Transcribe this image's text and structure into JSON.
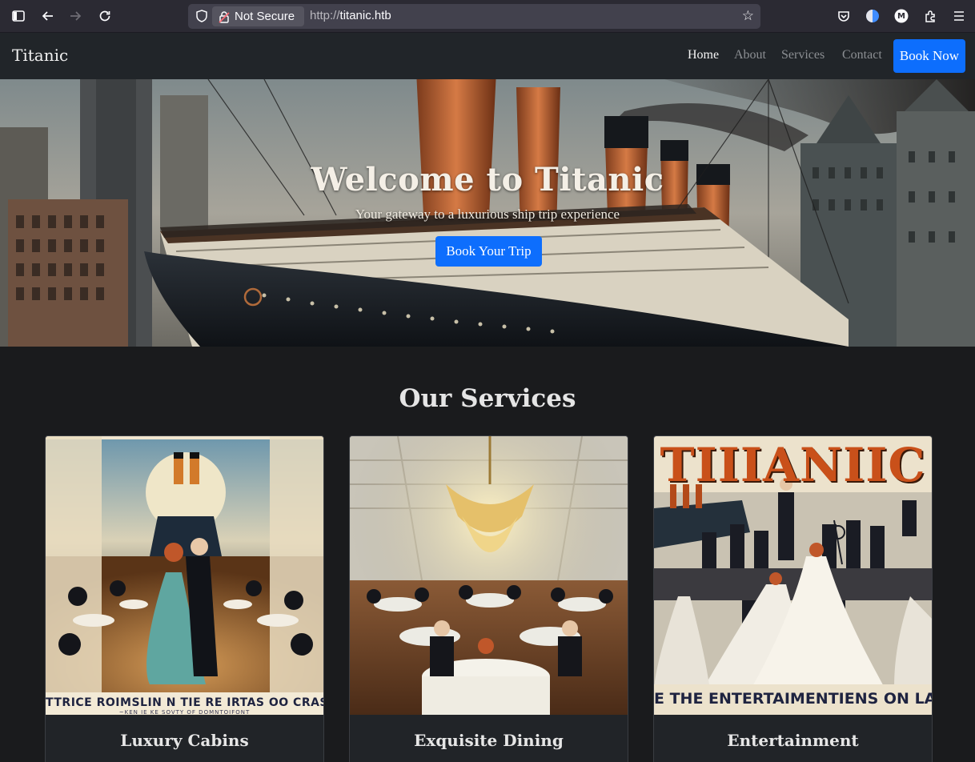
{
  "browser": {
    "security_label": "Not Secure",
    "url_scheme": "http://",
    "url_host": "titanic.htb",
    "profile_initial": "M"
  },
  "navbar": {
    "brand": "Titanic",
    "links": [
      {
        "label": "Home",
        "active": true
      },
      {
        "label": "About",
        "active": false
      },
      {
        "label": "Services",
        "active": false
      },
      {
        "label": "Contact",
        "active": false
      }
    ],
    "cta_label": "Book Now"
  },
  "hero": {
    "title": "Welcome to Titanic",
    "subtitle": "Your gateway to a luxurious ship trip experience",
    "button_label": "Book Your Trip"
  },
  "services": {
    "heading": "Our Services",
    "cards": [
      {
        "title": "Luxury Cabins",
        "poster_caption": "TTRICE ROIMSLIN N TIE RE IRTAS OO CRAS I",
        "poster_sub": "~KEN IE KE SOVTY OF DOMNTOIFONT"
      },
      {
        "title": "Exquisite Dining"
      },
      {
        "title": "Entertainment",
        "poster_title": "TIIIANIIC",
        "poster_caption": "E THE ENTERTAIMENTIENS ON LAI"
      }
    ]
  },
  "colors": {
    "accent": "#0d6efd",
    "navbar_bg": "#212529",
    "page_bg": "#1a1b1d"
  }
}
